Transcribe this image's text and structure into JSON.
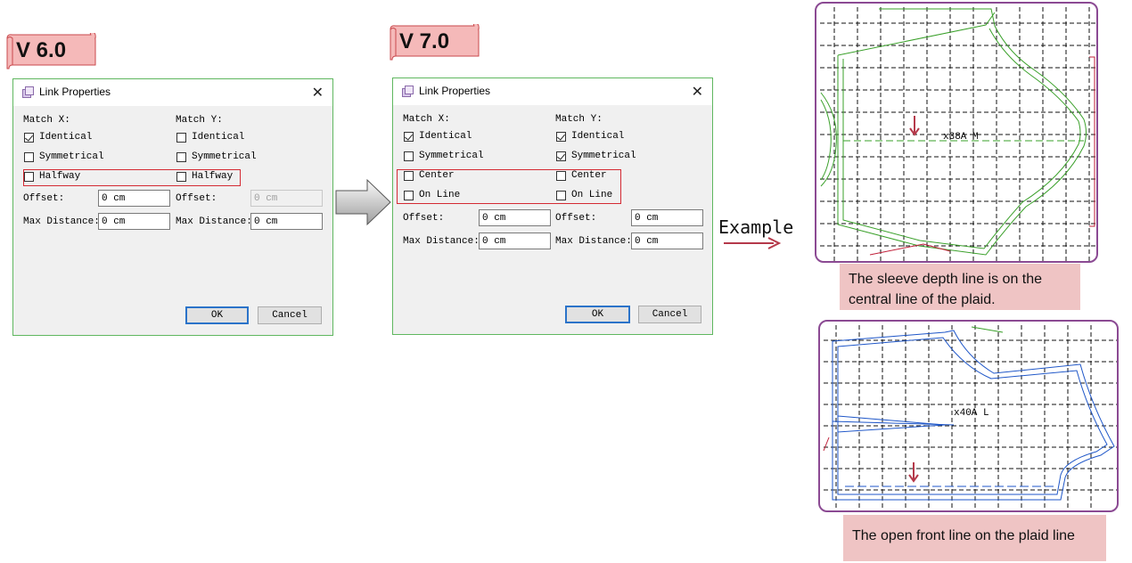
{
  "versions": {
    "v6": "V 6.0",
    "v7": "V 7.0"
  },
  "dialog_v6": {
    "title": "Link Properties",
    "close": "✕",
    "match_x_label": "Match X:",
    "match_y_label": "Match Y:",
    "x_options": [
      {
        "label": "Identical",
        "checked": true
      },
      {
        "label": "Symmetrical",
        "checked": false
      },
      {
        "label": "Halfway",
        "checked": false
      }
    ],
    "y_options": [
      {
        "label": "Identical",
        "checked": false
      },
      {
        "label": "Symmetrical",
        "checked": false
      },
      {
        "label": "Halfway",
        "checked": false
      }
    ],
    "offset_label": "Offset:",
    "offset_x": "0 cm",
    "offset_y": "0 cm",
    "max_distance_label": "Max Distance:",
    "max_distance_x": "0 cm",
    "max_distance_y": "0 cm",
    "ok": "OK",
    "cancel": "Cancel"
  },
  "dialog_v7": {
    "title": "Link Properties",
    "close": "✕",
    "match_x_label": "Match X:",
    "match_y_label": "Match Y:",
    "x_options": [
      {
        "label": "Identical",
        "checked": true
      },
      {
        "label": "Symmetrical",
        "checked": false
      },
      {
        "label": "Center",
        "checked": false
      },
      {
        "label": "On Line",
        "checked": false
      }
    ],
    "y_options": [
      {
        "label": "Identical",
        "checked": true
      },
      {
        "label": "Symmetrical",
        "checked": true
      },
      {
        "label": "Center",
        "checked": false
      },
      {
        "label": "On Line",
        "checked": false
      }
    ],
    "offset_label": "Offset:",
    "offset_x": "0 cm",
    "offset_y": "0 cm",
    "max_distance_label": "Max Distance:",
    "max_distance_x": "0 cm",
    "max_distance_y": "0 cm",
    "ok": "OK",
    "cancel": "Cancel"
  },
  "example": {
    "label": "Example",
    "sleeve_piece_label": "x38A M",
    "front_piece_label": "x40A L",
    "caption_1": "The sleeve depth line is on the central line of the plaid.",
    "caption_2": "The open front line on the plaid line"
  },
  "colors": {
    "dialog_border": "#5fb75f",
    "highlight_red": "#d42a33",
    "panel_border": "#8b4a93",
    "caption_bg": "#efc4c4",
    "sleeve_line": "#3aa02a",
    "front_line": "#1e56c8",
    "marker_red": "#b5394a"
  }
}
